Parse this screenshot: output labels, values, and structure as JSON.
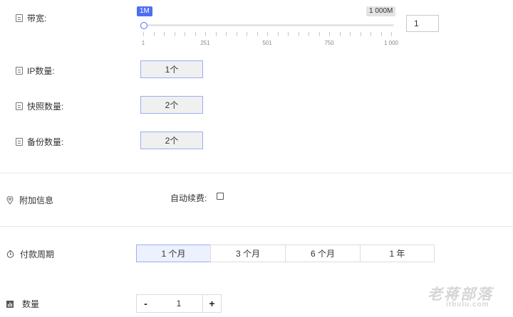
{
  "bandwidth": {
    "label": "带宽:",
    "min_badge": "1M",
    "max_badge": "1 000M",
    "ticks": [
      "1",
      "251",
      "501",
      "750",
      "1 000"
    ],
    "input_value": "1"
  },
  "ip": {
    "label": "IP数量:",
    "value": "1个"
  },
  "snapshot": {
    "label": "快照数量:",
    "value": "2个"
  },
  "backup": {
    "label": "备份数量:",
    "value": "2个"
  },
  "extra": {
    "label": "附加信息",
    "auto_renew_label": "自动续费:"
  },
  "payment": {
    "label": "付款周期",
    "options": [
      "1 个月",
      "3 个月",
      "6 个月",
      "1 年"
    ]
  },
  "quantity": {
    "label": "数量",
    "minus": "-",
    "value": "1",
    "plus": "+"
  },
  "watermark": {
    "title": "老蒋部落",
    "sub": "itbulu.com"
  }
}
